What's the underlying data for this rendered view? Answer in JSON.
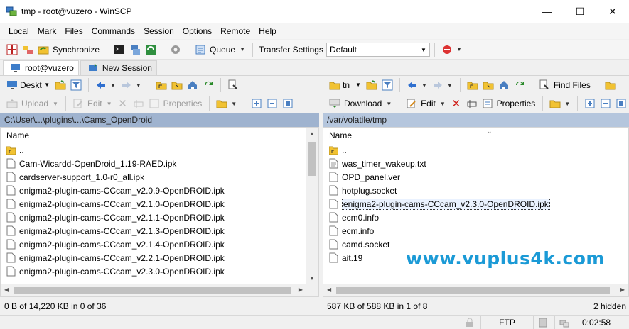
{
  "window": {
    "title": "tmp - root@vuzero - WinSCP"
  },
  "menu": [
    "Local",
    "Mark",
    "Files",
    "Commands",
    "Session",
    "Options",
    "Remote",
    "Help"
  ],
  "toolbar": {
    "synchronize": "Synchronize",
    "queue": "Queue",
    "transfer_settings_label": "Transfer Settings",
    "transfer_settings_value": "Default"
  },
  "tabs": [
    {
      "label": "root@vuzero"
    },
    {
      "label": "New Session"
    }
  ],
  "left": {
    "drive": "Deskt",
    "upload": "Upload",
    "edit": "Edit",
    "properties": "Properties",
    "path": "C:\\User\\...\\plugins\\...\\Cams_OpenDroid",
    "column_name": "Name",
    "files": [
      "..",
      "Cam-Wicardd-OpenDroid_1.19-RAED.ipk",
      "cardserver-support_1.0-r0_all.ipk",
      "enigma2-plugin-cams-CCcam_v2.0.9-OpenDROID.ipk",
      "enigma2-plugin-cams-CCcam_v2.1.0-OpenDROID.ipk",
      "enigma2-plugin-cams-CCcam_v2.1.1-OpenDROID.ipk",
      "enigma2-plugin-cams-CCcam_v2.1.3-OpenDROID.ipk",
      "enigma2-plugin-cams-CCcam_v2.1.4-OpenDROID.ipk",
      "enigma2-plugin-cams-CCcam_v2.2.1-OpenDROID.ipk",
      "enigma2-plugin-cams-CCcam_v2.3.0-OpenDROID.ipk"
    ],
    "status": "0 B of 14,220 KB in 0 of 36"
  },
  "right": {
    "drive": "tn",
    "find_files": "Find Files",
    "download": "Download",
    "edit": "Edit",
    "properties": "Properties",
    "path": "/var/volatile/tmp",
    "column_name": "Name",
    "files": [
      "..",
      "was_timer_wakeup.txt",
      "OPD_panel.ver",
      "hotplug.socket",
      "enigma2-plugin-cams-CCcam_v2.3.0-OpenDROID.ipk",
      "ecm0.info",
      "ecm.info",
      "camd.socket",
      "ait.19"
    ],
    "selected_index": 4,
    "status": "587 KB of 588 KB in 1 of 8",
    "hidden": "2 hidden"
  },
  "statusbar": {
    "protocol": "FTP",
    "timer": "0:02:58"
  },
  "watermark": "www.vuplus4k.com",
  "colors": {
    "path_left": "#9fb3cf",
    "path_right": "#b5c6dd",
    "watermark": "#1b9ad6"
  }
}
